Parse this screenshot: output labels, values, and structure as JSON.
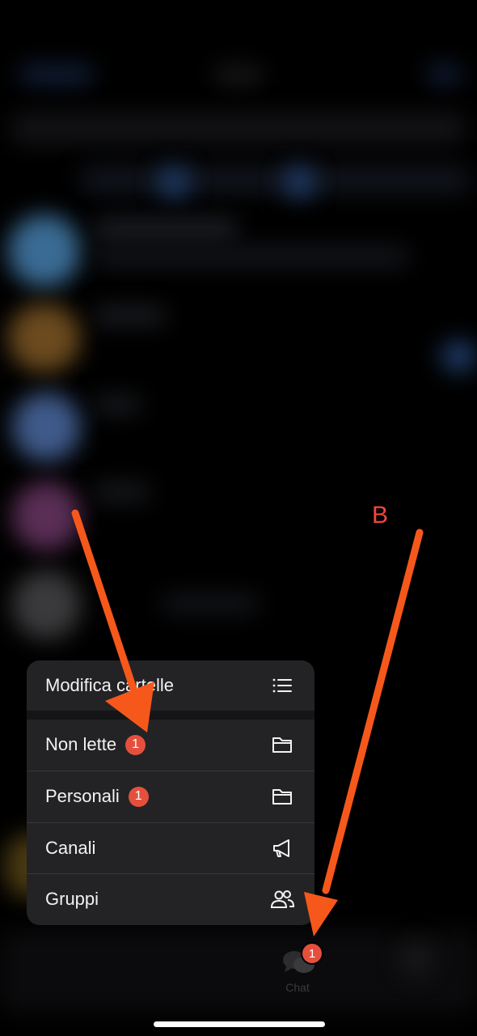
{
  "menu": {
    "items": [
      {
        "label": "Modifica cartelle",
        "icon": "list-icon"
      },
      {
        "label": "Non lette",
        "badge": "1",
        "icon": "folder-icon"
      },
      {
        "label": "Personali",
        "badge": "1",
        "icon": "folder-icon"
      },
      {
        "label": "Canali",
        "icon": "megaphone-icon"
      },
      {
        "label": "Gruppi",
        "icon": "people-icon"
      }
    ]
  },
  "tabbar": {
    "chat_label": "Chat",
    "chat_badge": "1",
    "chat_icon": "chat-bubbles-icon"
  },
  "annotations": {
    "b_label": "B",
    "arrow_color": "#f6581c"
  },
  "colors": {
    "badge": "#e5503d",
    "menu_background": "#232325",
    "annotation_red": "#f2473b"
  }
}
